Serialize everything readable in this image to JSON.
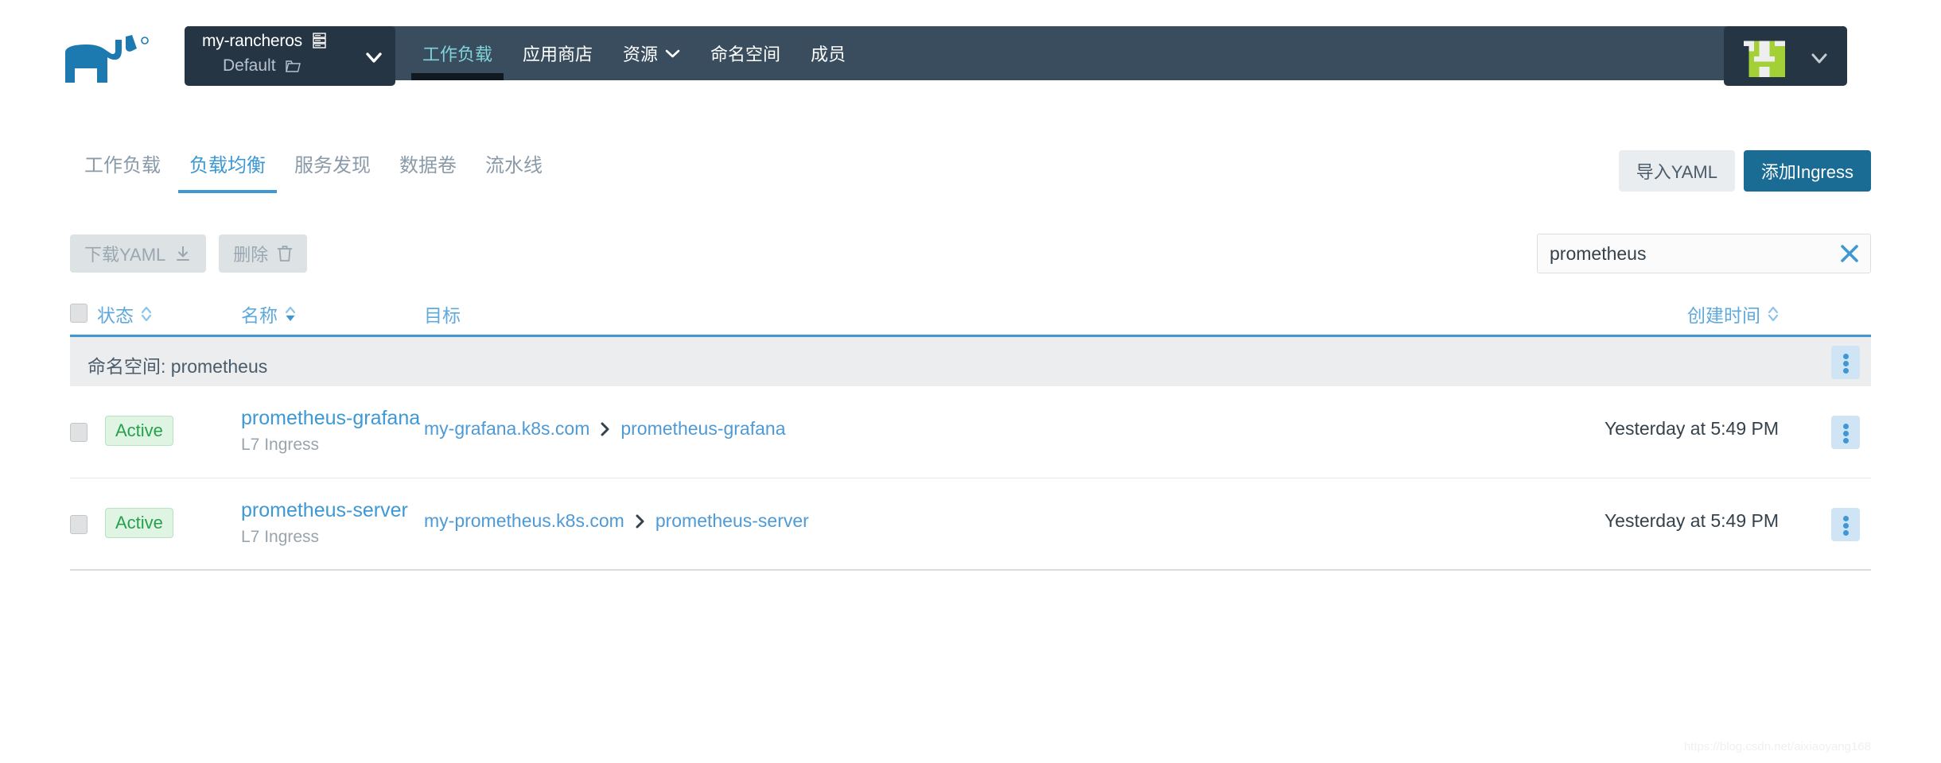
{
  "header": {
    "logo_icon": "rancher-cow-logo",
    "project_picker": {
      "cluster": "my-rancheros",
      "cluster_icon": "server-icon",
      "project": "Default",
      "project_icon": "folder-icon",
      "caret_icon": "chevron-down-icon"
    },
    "nav": [
      {
        "label": "工作负载",
        "active": true
      },
      {
        "label": "应用商店",
        "active": false
      },
      {
        "label": "资源",
        "active": false,
        "caret_icon": "chevron-down-icon"
      },
      {
        "label": "命名空间",
        "active": false
      },
      {
        "label": "成员",
        "active": false
      }
    ],
    "user": {
      "avatar_icon": "user-identicon-avatar",
      "caret_icon": "chevron-down-icon"
    }
  },
  "subtabs": [
    {
      "label": "工作负载",
      "active": false
    },
    {
      "label": "负载均衡",
      "active": true
    },
    {
      "label": "服务发现",
      "active": false
    },
    {
      "label": "数据卷",
      "active": false
    },
    {
      "label": "流水线",
      "active": false
    }
  ],
  "page_actions": {
    "import_yaml_label": "导入YAML",
    "add_ingress_label": "添加Ingress"
  },
  "bulk_actions": [
    {
      "label": "下载YAML",
      "icon": "download-icon"
    },
    {
      "label": "删除",
      "icon": "trash-icon"
    }
  ],
  "search": {
    "value": "prometheus",
    "placeholder": "",
    "clear_icon": "close-icon"
  },
  "table": {
    "columns": [
      {
        "label": "状态",
        "sort_icon": "sort-both-icon"
      },
      {
        "label": "名称",
        "sort_icon": "sort-desc-icon"
      },
      {
        "label": "目标",
        "sort_icon": ""
      },
      {
        "label": "创建时间",
        "sort_icon": "sort-both-icon"
      }
    ],
    "group": {
      "prefix": "命名空间:",
      "name": "prometheus",
      "label": "命名空间: prometheus",
      "menu_icon": "kebab-menu-icon"
    },
    "rows": [
      {
        "status": "Active",
        "name": "prometheus-grafana",
        "type": "L7 Ingress",
        "target_host": "my-grafana.k8s.com",
        "target_sep_icon": "chevron-right-icon",
        "target_service": "prometheus-grafana",
        "created": "Yesterday at 5:49 PM",
        "menu_icon": "kebab-menu-icon"
      },
      {
        "status": "Active",
        "name": "prometheus-server",
        "type": "L7 Ingress",
        "target_host": "my-prometheus.k8s.com",
        "target_sep_icon": "chevron-right-icon",
        "target_service": "prometheus-server",
        "created": "Yesterday at 5:49 PM",
        "menu_icon": "kebab-menu-icon"
      }
    ]
  },
  "watermark": "https://blog.csdn.net/aixiaoyang168",
  "colors": {
    "header_bg": "#3a4d5e",
    "header_dark": "#263544",
    "accent_link": "#3d98d3",
    "primary_button": "#1b6c94",
    "nav_active": "#7fd3d9",
    "status_green": "#25a14c",
    "avatar_green": "#a4d037"
  }
}
